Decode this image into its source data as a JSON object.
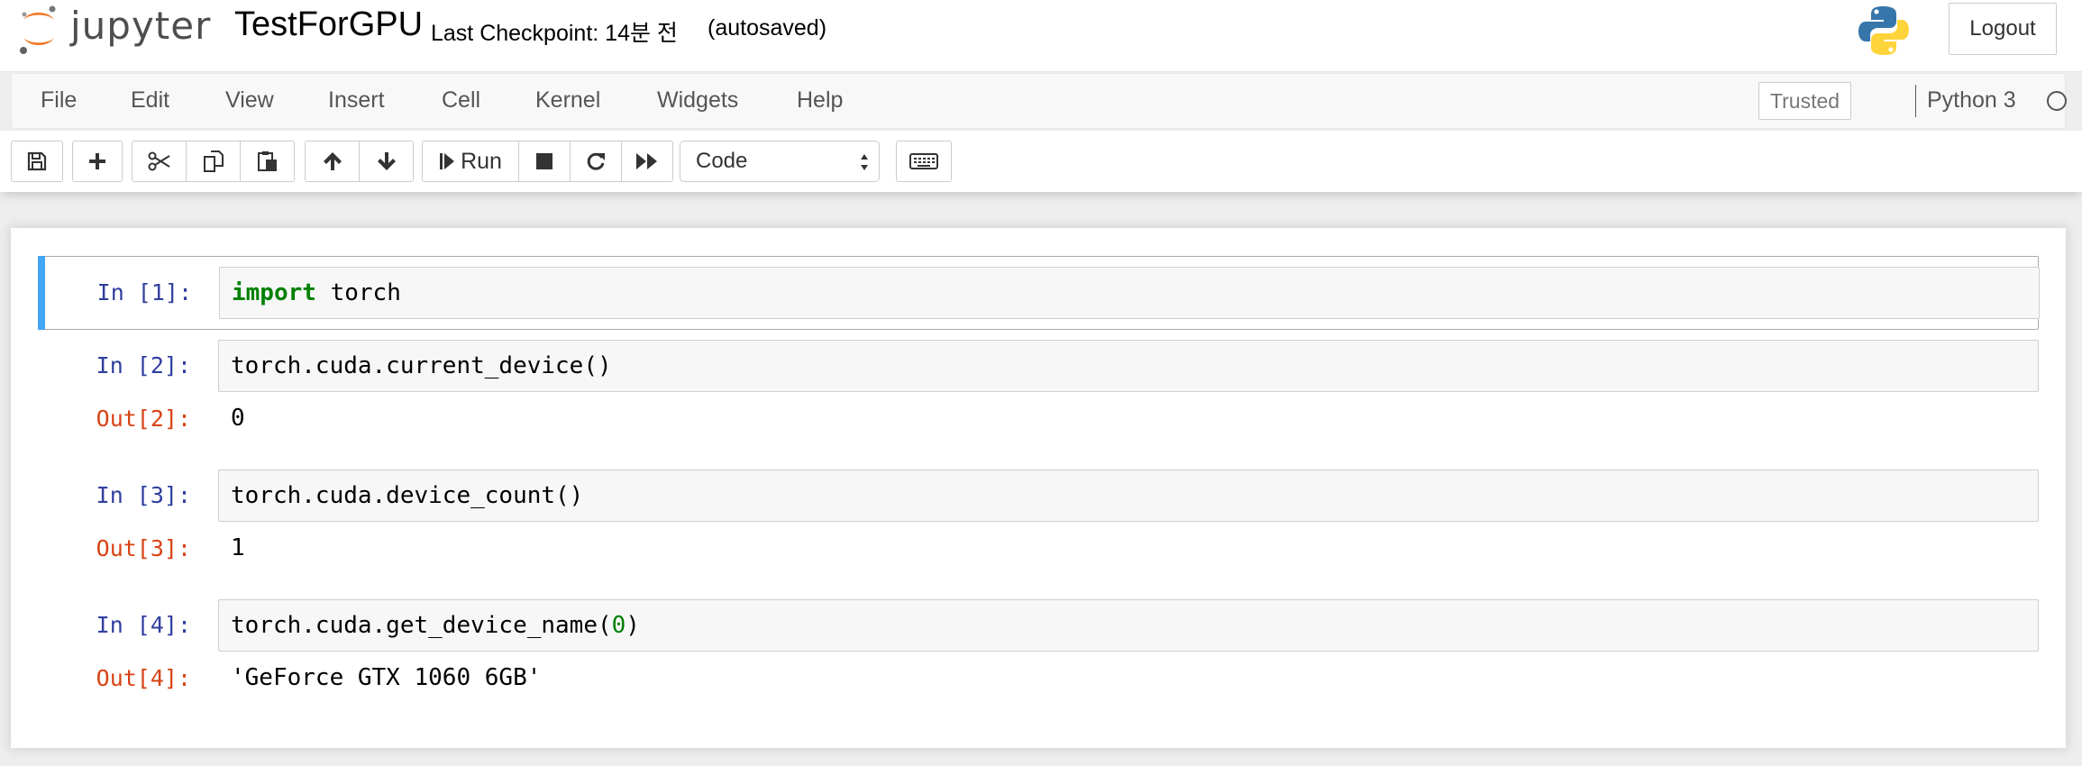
{
  "header": {
    "logo_text": "jupyter",
    "notebook_name": "TestForGPU",
    "checkpoint": "Last Checkpoint: 14분 전",
    "autosave_status": "(autosaved)",
    "logout_label": "Logout"
  },
  "menubar": {
    "items": [
      {
        "label": "File"
      },
      {
        "label": "Edit"
      },
      {
        "label": "View"
      },
      {
        "label": "Insert"
      },
      {
        "label": "Cell"
      },
      {
        "label": "Kernel"
      },
      {
        "label": "Widgets"
      },
      {
        "label": "Help"
      }
    ],
    "trusted_label": "Trusted",
    "kernel_name": "Python 3"
  },
  "toolbar": {
    "run_label": "Run",
    "cell_type": "Code",
    "icons": [
      "save-icon",
      "plus-icon",
      "cut-icon",
      "copy-icon",
      "paste-icon",
      "arrow-up-icon",
      "arrow-down-icon",
      "step-forward-icon",
      "stop-icon",
      "restart-icon",
      "fast-forward-icon",
      "keyboard-icon"
    ]
  },
  "cells": [
    {
      "in_prompt": "In [1]:",
      "code": {
        "kw": "import",
        "rest": " torch"
      }
    },
    {
      "in_prompt": "In [2]:",
      "code": {
        "text": "torch.cuda.current_device()"
      },
      "out_prompt": "Out[2]:",
      "output": "0"
    },
    {
      "in_prompt": "In [3]:",
      "code": {
        "text": "torch.cuda.device_count()"
      },
      "out_prompt": "Out[3]:",
      "output": "1"
    },
    {
      "in_prompt": "In [4]:",
      "code": {
        "pre": "torch.cuda.get_device_name(",
        "num": "0",
        "post": ")"
      },
      "out_prompt": "Out[4]:",
      "output": "'GeForce GTX 1060 6GB'"
    }
  ],
  "colors": {
    "in_prompt": "#303f9f",
    "out_prompt": "#d84315",
    "selected_cell_bar": "#42a5f5",
    "keyword": "#008000"
  }
}
